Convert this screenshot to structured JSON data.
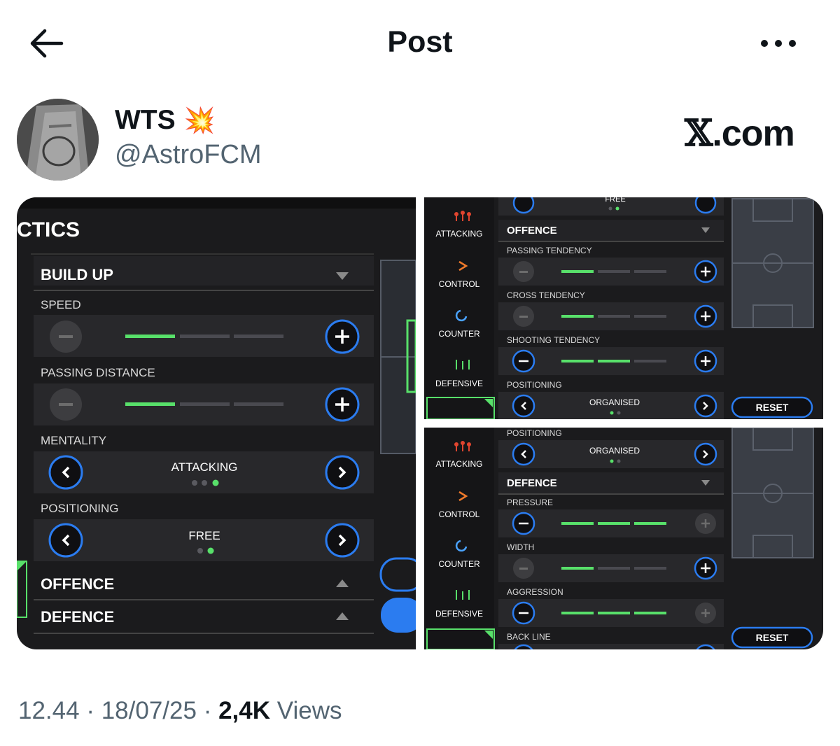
{
  "header": {
    "title": "Post"
  },
  "author": {
    "display_name": "WTS",
    "emoji": "💥",
    "handle": "@AstroFCM"
  },
  "brand": {
    "x": "𝕏",
    "domain": ".com"
  },
  "panel_left": {
    "title": "CTICS",
    "section": "BUILD UP",
    "rows": [
      {
        "label": "SPEED",
        "type": "slider",
        "level": 1
      },
      {
        "label": "PASSING DISTANCE",
        "type": "slider",
        "level": 1
      },
      {
        "label": "MENTALITY",
        "type": "selector",
        "value": "ATTACKING",
        "dots": 3,
        "active_dot": 3
      },
      {
        "label": "POSITIONING",
        "type": "selector",
        "value": "FREE",
        "dots": 2,
        "active_dot": 2
      }
    ],
    "collapsed_sections": [
      "OFFENCE",
      "DEFENCE"
    ]
  },
  "panel_top_right": {
    "sidebar": [
      "ATTACKING",
      "CONTROL",
      "COUNTER",
      "DEFENSIVE"
    ],
    "cut_value": "FREE",
    "section": "OFFENCE",
    "rows": [
      {
        "label": "PASSING TENDENCY",
        "type": "slider",
        "level": 1
      },
      {
        "label": "CROSS TENDENCY",
        "type": "slider",
        "level": 1
      },
      {
        "label": "SHOOTING TENDENCY",
        "type": "slider",
        "level": 2
      },
      {
        "label": "POSITIONING",
        "type": "selector",
        "value": "ORGANISED",
        "dots": 2,
        "active_dot": 1
      }
    ],
    "reset": "RESET"
  },
  "panel_bottom_right": {
    "sidebar": [
      "ATTACKING",
      "CONTROL",
      "COUNTER",
      "DEFENSIVE"
    ],
    "top_label": "POSITIONING",
    "top_value": "ORGANISED",
    "section": "DEFENCE",
    "rows": [
      {
        "label": "PRESSURE",
        "type": "slider",
        "level": 3
      },
      {
        "label": "WIDTH",
        "type": "slider",
        "level": 1
      },
      {
        "label": "AGGRESSION",
        "type": "slider",
        "level": 3
      },
      {
        "label": "BACK LINE",
        "type": "cut"
      }
    ],
    "reset": "RESET"
  },
  "footer": {
    "time": "12.44",
    "date": "18/07/25",
    "views_count": "2,4K",
    "views_label": "Views",
    "sep": "·"
  },
  "colors": {
    "accent_green": "#58e06a",
    "accent_blue": "#2b7cf0",
    "panel_bg": "#1b1b1d",
    "muted_text": "#536471"
  }
}
